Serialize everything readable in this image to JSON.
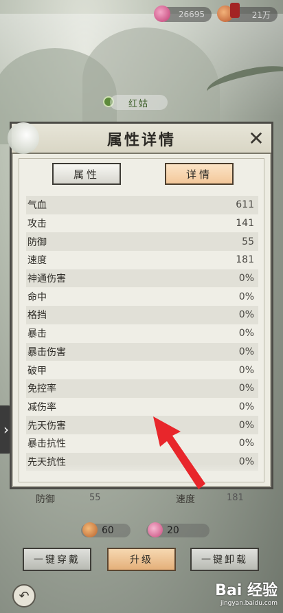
{
  "top_bar": {
    "jade_value": "26695",
    "token_value": "21万"
  },
  "character_name": "红姑",
  "modal": {
    "title": "属性详情",
    "close_symbol": "✕",
    "tabs": [
      {
        "label": "属性",
        "active": false
      },
      {
        "label": "详情",
        "active": true
      }
    ],
    "stats": [
      {
        "name": "气血",
        "value": "611"
      },
      {
        "name": "攻击",
        "value": "141"
      },
      {
        "name": "防御",
        "value": "55"
      },
      {
        "name": "速度",
        "value": "181"
      },
      {
        "name": "神通伤害",
        "value": "0%"
      },
      {
        "name": "命中",
        "value": "0%"
      },
      {
        "name": "格挡",
        "value": "0%"
      },
      {
        "name": "暴击",
        "value": "0%"
      },
      {
        "name": "暴击伤害",
        "value": "0%"
      },
      {
        "name": "破甲",
        "value": "0%"
      },
      {
        "name": "免控率",
        "value": "0%"
      },
      {
        "name": "减伤率",
        "value": "0%"
      },
      {
        "name": "先天伤害",
        "value": "0%"
      },
      {
        "name": "暴击抗性",
        "value": "0%"
      },
      {
        "name": "先天抗性",
        "value": "0%"
      }
    ]
  },
  "below_stats": {
    "defense_label": "防御",
    "defense_value": "55",
    "speed_label": "速度",
    "speed_value": "181"
  },
  "costs": {
    "fruit": "60",
    "gem": "20"
  },
  "actions": {
    "equip_all": "一键穿戴",
    "upgrade": "升级",
    "unequip_all": "一键卸载"
  },
  "watermark": {
    "logo": "Bai 经验",
    "url": "jingyan.baidu.com"
  },
  "colors": {
    "annotation_arrow": "#e8262b",
    "active_tab": "#f3c89a",
    "modal_bg": "#edece2"
  }
}
